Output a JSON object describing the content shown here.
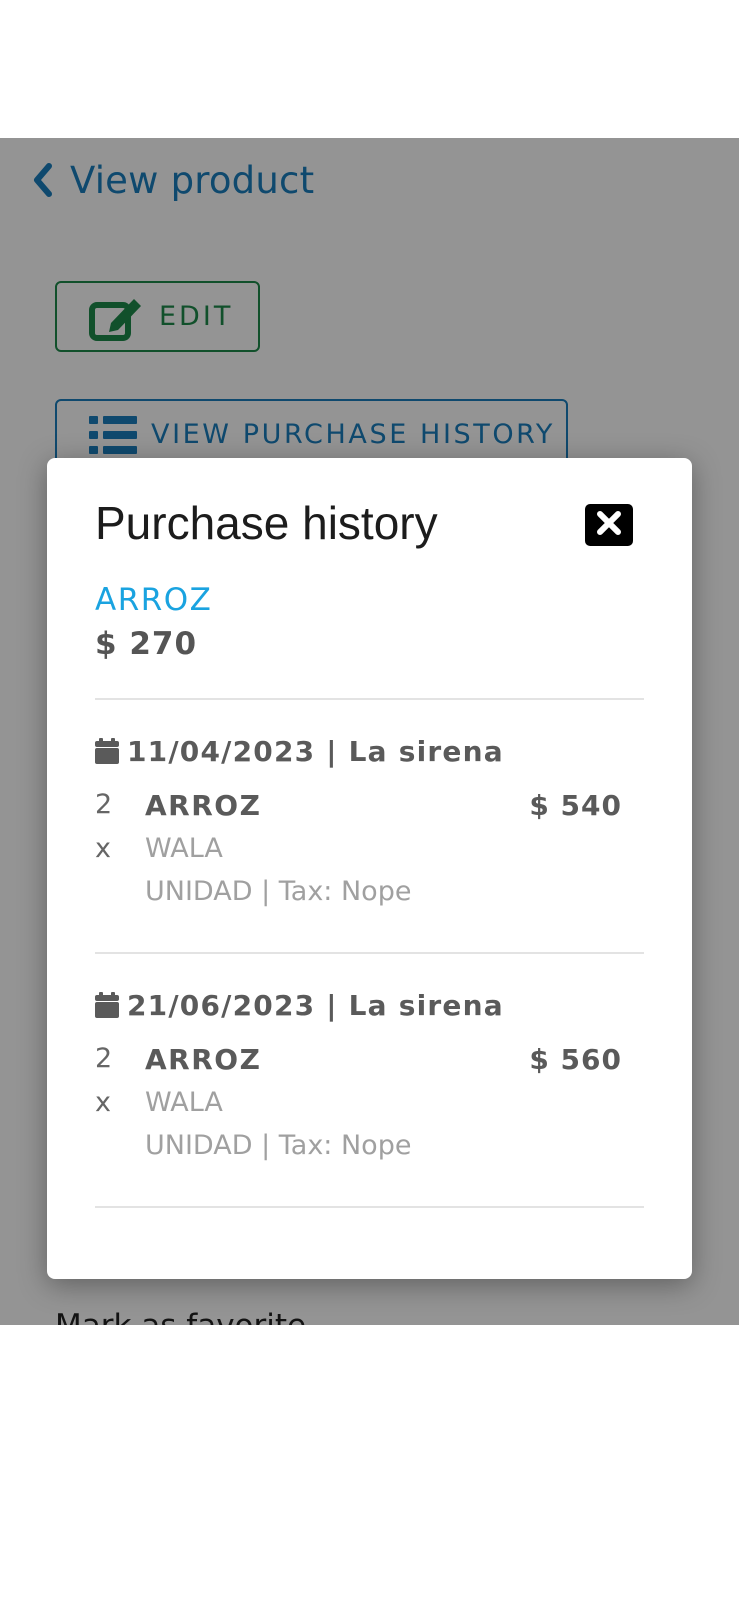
{
  "header": {
    "back_label": "View product"
  },
  "actions": {
    "edit_label": "EDIT",
    "history_label": "VIEW PURCHASE HISTORY",
    "favorite_label": "Mark as favorite"
  },
  "modal": {
    "title": "Purchase history",
    "product": {
      "name": "ARROZ",
      "price": "$ 270"
    },
    "entries": [
      {
        "date_store": "11/04/2023 | La sirena",
        "quantity": "2",
        "multiplier": "x",
        "name": "ARROZ",
        "brand": "WALA",
        "meta": "UNIDAD | Tax: Nope",
        "price": "$ 540"
      },
      {
        "date_store": "21/06/2023 | La sirena",
        "quantity": "2",
        "multiplier": "x",
        "name": "ARROZ",
        "brand": "WALA",
        "meta": "UNIDAD | Tax: Nope",
        "price": "$ 560"
      }
    ]
  },
  "icons": {
    "back": "chevron-left-icon",
    "edit": "edit-icon",
    "history": "list-icon",
    "close": "close-icon",
    "calendar": "calendar-icon"
  },
  "colors": {
    "link_blue": "#1a7fbd",
    "accent_cyan": "#1aa3e0",
    "edit_green": "#1e8a4a",
    "text_gray": "#5a5a5a"
  }
}
